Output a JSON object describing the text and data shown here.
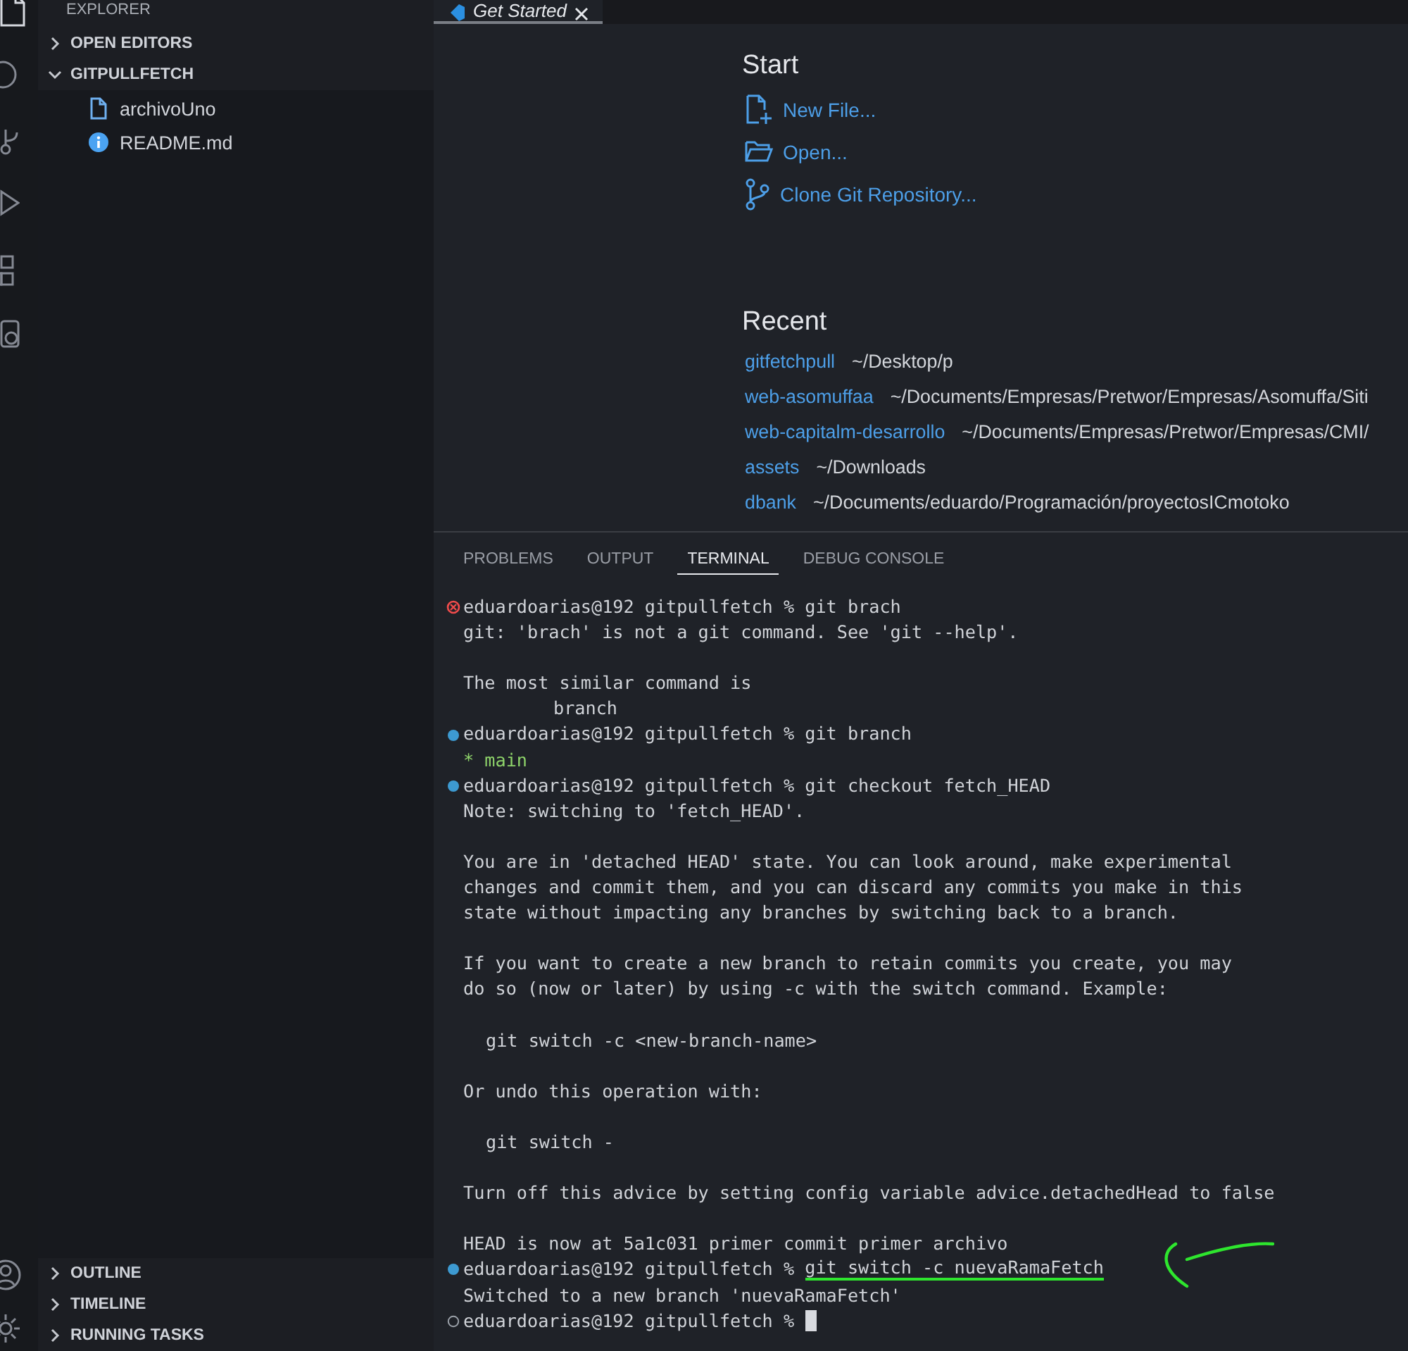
{
  "sidebar": {
    "title": "EXPLORER",
    "sections": [
      {
        "label": "OPEN EDITORS",
        "expanded": false
      },
      {
        "label": "GITPULLFETCH",
        "expanded": true,
        "children": [
          {
            "name": "archivoUno",
            "kind": "file"
          },
          {
            "name": "README.md",
            "kind": "info"
          }
        ]
      }
    ],
    "bottom_sections": [
      {
        "label": "OUTLINE",
        "expanded": false
      },
      {
        "label": "TIMELINE",
        "expanded": false
      },
      {
        "label": "RUNNING TASKS",
        "expanded": false
      }
    ]
  },
  "editor": {
    "tabs": [
      {
        "label": "Get Started",
        "selected": true
      }
    ],
    "start": {
      "title": "Start",
      "actions": [
        {
          "label": "New File...",
          "kind": "new-file"
        },
        {
          "label": "Open...",
          "kind": "open"
        },
        {
          "label": "Clone Git Repository...",
          "kind": "clone"
        }
      ]
    },
    "recent": {
      "title": "Recent",
      "items": [
        {
          "name": "gitfetchpull",
          "path": "~/Desktop/p"
        },
        {
          "name": "web-asomuffaa",
          "path": "~/Documents/Empresas/Pretwor/Empresas/Asomuffa/Siti"
        },
        {
          "name": "web-capitalm-desarrollo",
          "path": "~/Documents/Empresas/Pretwor/Empresas/CMI/"
        },
        {
          "name": "assets",
          "path": "~/Downloads"
        },
        {
          "name": "dbank",
          "path": "~/Documents/eduardo/Programación/proyectosICmotoko"
        }
      ]
    }
  },
  "panel": {
    "tabs": [
      {
        "label": "PROBLEMS",
        "selected": false
      },
      {
        "label": "OUTPUT",
        "selected": false
      },
      {
        "label": "TERMINAL",
        "selected": true
      },
      {
        "label": "DEBUG CONSOLE",
        "selected": false
      }
    ],
    "terminal": {
      "lines": [
        {
          "kind": "prompt",
          "completed": true,
          "failed": true,
          "prompt": "eduardoarias@192 gitpullfetch %",
          "command": "git brach",
          "highlighted": false
        },
        {
          "kind": "output",
          "text": "git: 'brach' is not a git command. See 'git --help'."
        },
        {
          "kind": "blank"
        },
        {
          "kind": "output",
          "text": "The most similar command is"
        },
        {
          "kind": "suggestion",
          "text": "branch"
        },
        {
          "kind": "prompt",
          "completed": true,
          "failed": false,
          "prompt": "eduardoarias@192 gitpullfetch %",
          "command": "git branch",
          "highlighted": false
        },
        {
          "kind": "branch",
          "text": "* main"
        },
        {
          "kind": "prompt",
          "completed": true,
          "failed": false,
          "prompt": "eduardoarias@192 gitpullfetch %",
          "command": "git checkout fetch_HEAD",
          "highlighted": false
        },
        {
          "kind": "output",
          "text": "Note: switching to 'fetch_HEAD'."
        },
        {
          "kind": "blank"
        },
        {
          "kind": "output",
          "text": "You are in 'detached HEAD' state. You can look around, make experimental"
        },
        {
          "kind": "output",
          "text": "changes and commit them, and you can discard any commits you make in this"
        },
        {
          "kind": "output",
          "text": "state without impacting any branches by switching back to a branch."
        },
        {
          "kind": "blank"
        },
        {
          "kind": "output",
          "text": "If you want to create a new branch to retain commits you create, you may"
        },
        {
          "kind": "output",
          "text": "do so (now or later) by using -c with the switch command. Example:"
        },
        {
          "kind": "blank"
        },
        {
          "kind": "example",
          "text": "git switch -c <new-branch-name>"
        },
        {
          "kind": "blank"
        },
        {
          "kind": "output",
          "text": "Or undo this operation with:"
        },
        {
          "kind": "blank"
        },
        {
          "kind": "example",
          "text": "git switch -"
        },
        {
          "kind": "blank"
        },
        {
          "kind": "output",
          "text": "Turn off this advice by setting config variable advice.detachedHead to false"
        },
        {
          "kind": "blank"
        },
        {
          "kind": "output",
          "text": "HEAD is now at 5a1c031 primer commit primer archivo"
        },
        {
          "kind": "prompt",
          "completed": true,
          "failed": false,
          "prompt": "eduardoarias@192 gitpullfetch %",
          "command": "git switch -c nuevaRamaFetch",
          "highlighted": true
        },
        {
          "kind": "output",
          "text": "Switched to a new branch 'nuevaRamaFetch'"
        },
        {
          "kind": "prompt",
          "completed": false,
          "failed": false,
          "prompt": "eduardoarias@192 gitpullfetch %",
          "cursor": true,
          "highlighted": false
        }
      ]
    }
  }
}
